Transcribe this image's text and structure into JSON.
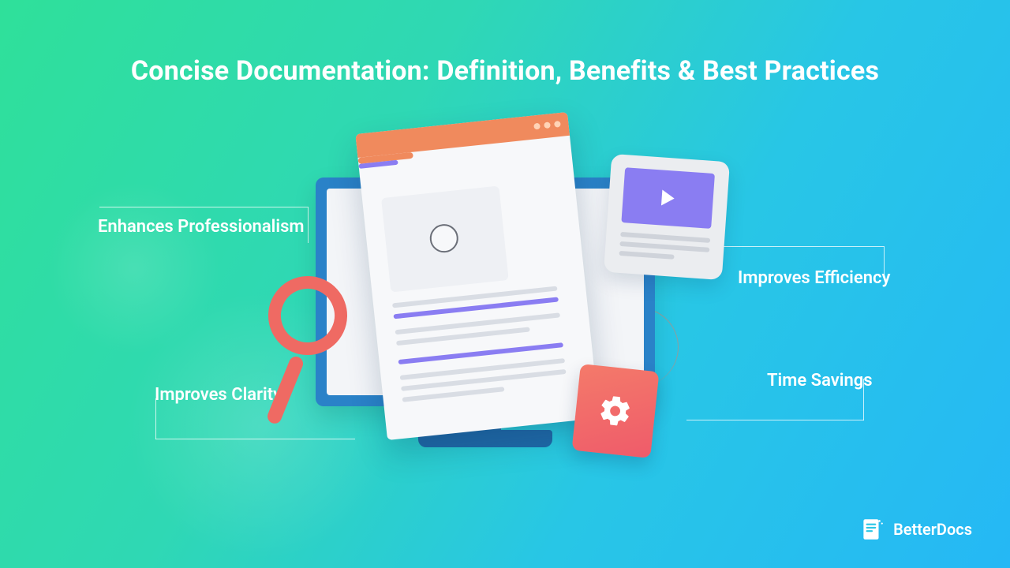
{
  "title": "Concise Documentation: Definition, Benefits & Best Practices",
  "callouts": {
    "top_left": "Enhances Professionalism",
    "bottom_left": "Improves Clarity",
    "top_right": "Improves Efficiency",
    "bottom_right": "Time Savings"
  },
  "brand": {
    "name": "BetterDocs"
  },
  "icons": {
    "magnifier": "magnifier-icon",
    "video": "play-icon",
    "settings": "gear-icon",
    "document": "document-icon",
    "monitor": "monitor-icon"
  },
  "colors": {
    "bg_from": "#2fe09a",
    "bg_to": "#25b8f5",
    "accent_orange": "#f08a5d",
    "accent_purple": "#8a7df2",
    "accent_red": "#ef5b6a",
    "monitor_blue": "#2a82c8"
  }
}
